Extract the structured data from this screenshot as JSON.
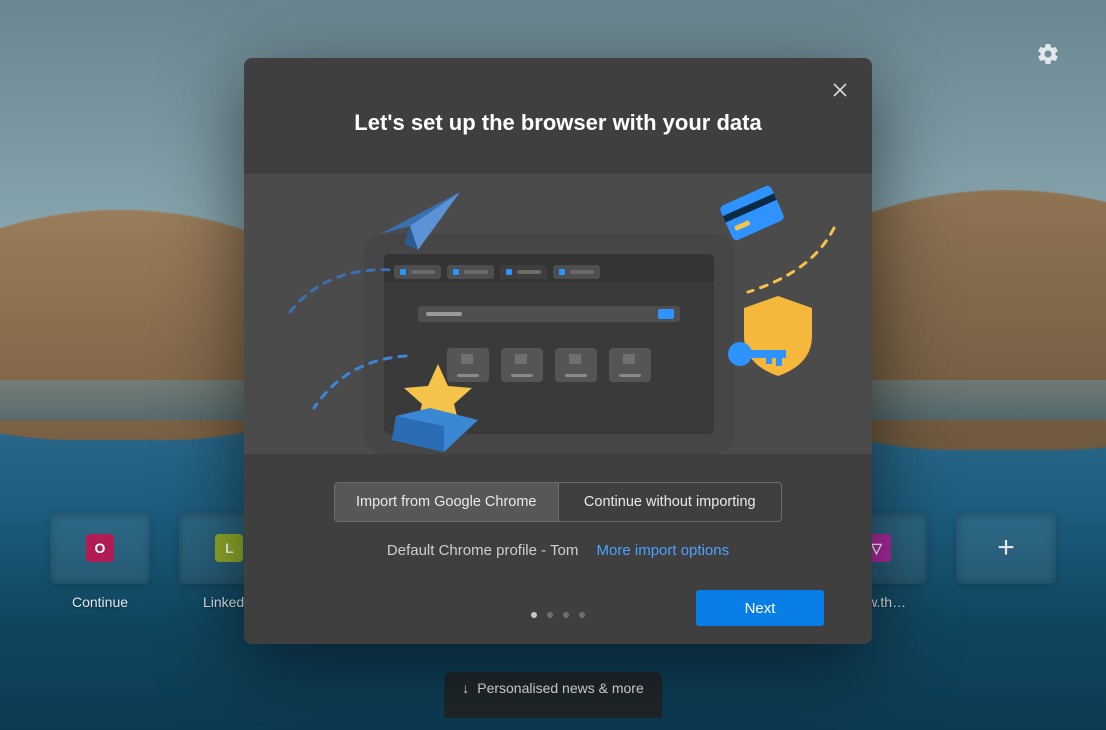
{
  "header": {
    "settings_icon": "gear-icon"
  },
  "tiles": [
    {
      "label": "Continue",
      "initial": "O",
      "color": "#b11c55"
    },
    {
      "label": "LinkedIn",
      "initial": "L",
      "color": "#93b02a"
    },
    {
      "label": "www.th…",
      "initial": "",
      "color": "#b02aa4",
      "glyph": "▽"
    }
  ],
  "bottom_pill": "Personalised news & more",
  "dialog": {
    "title": "Let's set up the browser with your data",
    "choice_import": "Import from Google Chrome",
    "choice_skip": "Continue without importing",
    "profile_text": "Default Chrome profile - Tom",
    "more_options": "More import options",
    "next": "Next",
    "page_index": 0,
    "page_total": 4
  }
}
